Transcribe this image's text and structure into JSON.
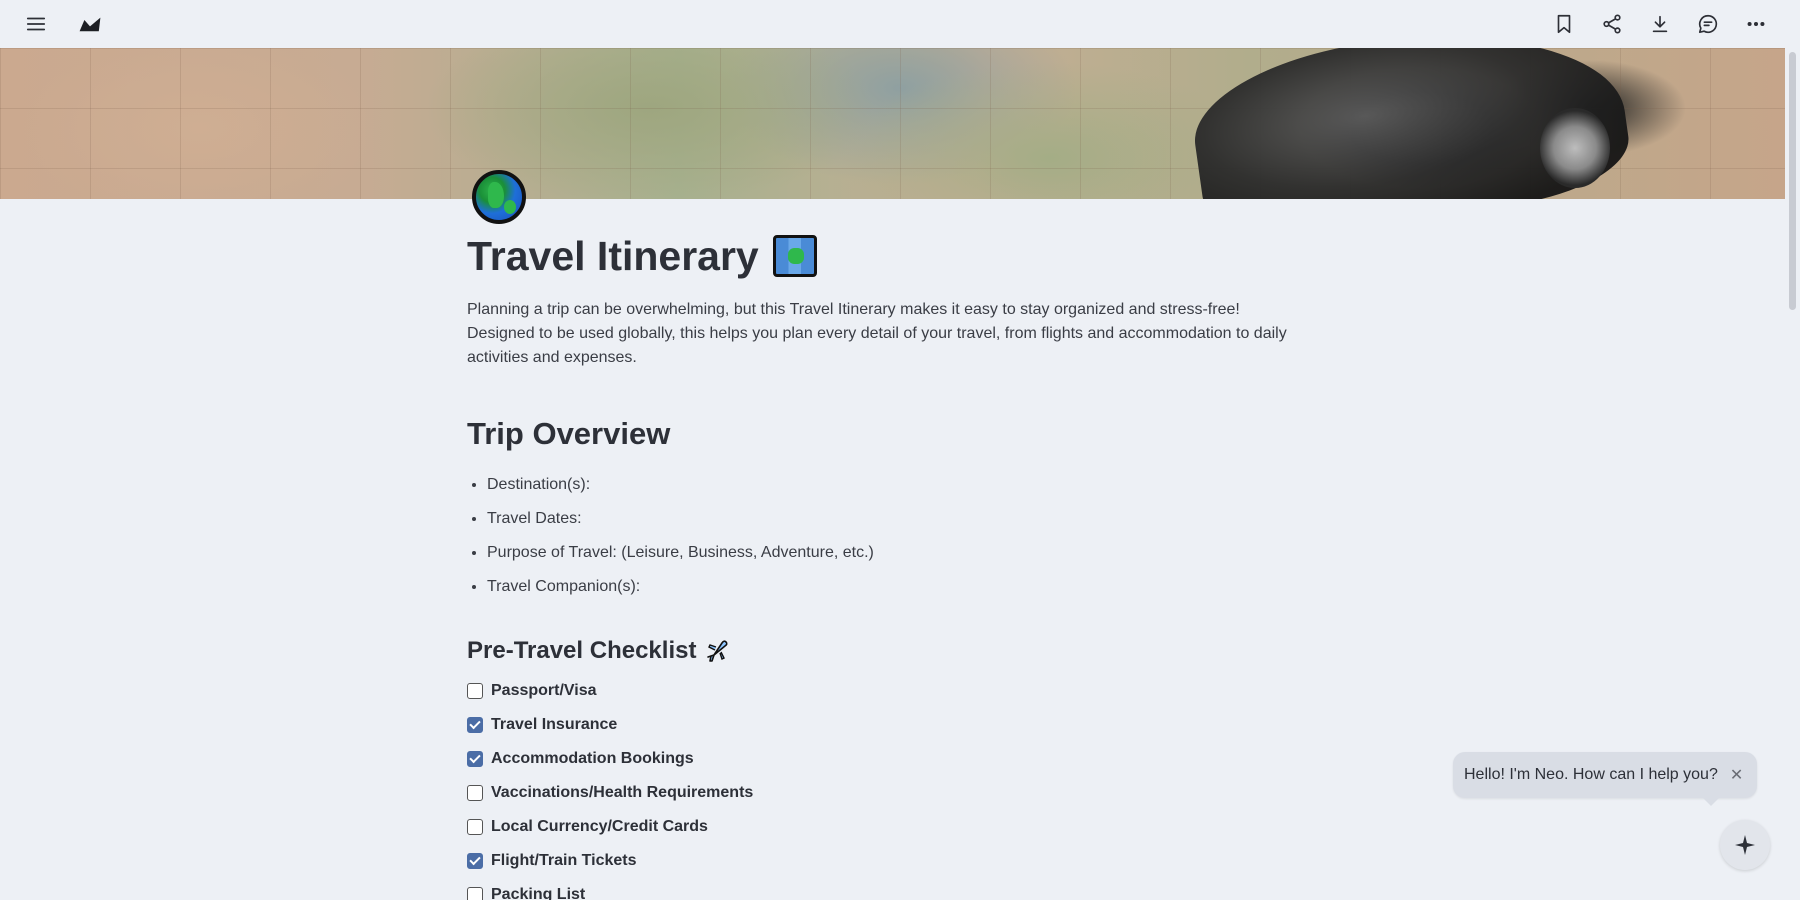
{
  "toolbar": {
    "menu_icon": "hamburger-icon",
    "logo_icon": "app-logo",
    "actions": [
      "bookmark-icon",
      "share-icon",
      "download-icon",
      "comment-icon",
      "more-icon"
    ]
  },
  "page": {
    "title": "Travel Itinerary",
    "title_emoji": "map-icon",
    "page_icon": "globe-icon",
    "intro": "Planning a trip can be overwhelming, but this Travel Itinerary makes it easy to stay organized and stress-free! Designed to be used globally, this helps you plan every detail of your travel, from flights and accommodation to daily activities and expenses."
  },
  "trip_overview": {
    "heading": "Trip Overview",
    "items": [
      "Destination(s):",
      "Travel Dates:",
      "Purpose of Travel: (Leisure, Business, Adventure, etc.)",
      "Travel Companion(s):"
    ]
  },
  "pre_travel": {
    "heading": "Pre-Travel Checklist",
    "heading_emoji": "airplane-icon",
    "items": [
      {
        "label": "Passport/Visa",
        "checked": false
      },
      {
        "label": "Travel Insurance",
        "checked": true
      },
      {
        "label": "Accommodation Bookings",
        "checked": true
      },
      {
        "label": "Vaccinations/Health Requirements",
        "checked": false
      },
      {
        "label": "Local Currency/Credit Cards",
        "checked": false
      },
      {
        "label": "Flight/Train Tickets",
        "checked": true
      },
      {
        "label": "Packing List",
        "checked": false
      }
    ]
  },
  "assistant": {
    "greeting": "Hello! I'm Neo. How can I help you?",
    "close_symbol": "✕",
    "fab_icon": "sparkle-icon"
  }
}
